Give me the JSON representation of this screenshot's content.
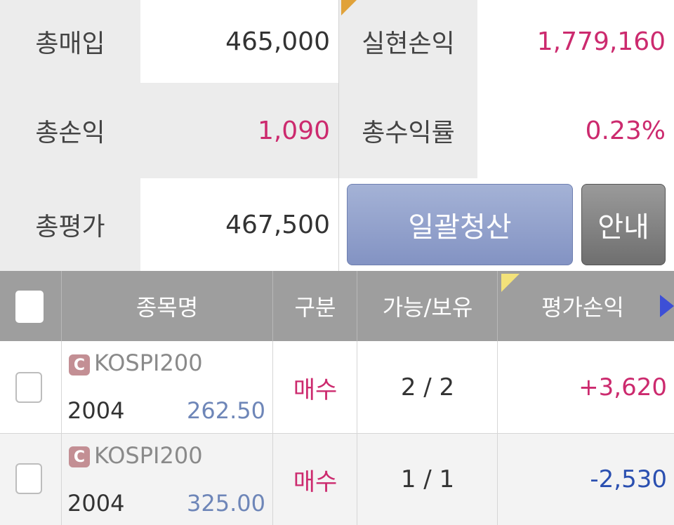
{
  "summary": {
    "row1": {
      "label_left": "총매입",
      "value_left": "465,000",
      "label_right": "실현손익",
      "value_right": "1,779,160"
    },
    "row2": {
      "label_left": "총손익",
      "value_left": "1,090",
      "label_right": "총수익률",
      "value_right": "0.23%"
    },
    "row3": {
      "label_left": "총평가",
      "value_left": "467,500"
    }
  },
  "buttons": {
    "liquidate_all": "일괄청산",
    "info": "안내"
  },
  "table": {
    "headers": {
      "name": "종목명",
      "type": "구분",
      "avail_hold": "가능/보유",
      "eval_pl": "평가손익"
    },
    "rows": [
      {
        "badge": "C",
        "symbol": "KOSPI200",
        "month": "2004",
        "strike": "262.50",
        "side": "매수",
        "qty": "2 / 2",
        "pl": "+3,620"
      },
      {
        "badge": "C",
        "symbol": "KOSPI200",
        "month": "2004",
        "strike": "325.00",
        "side": "매수",
        "qty": "1 / 1",
        "pl": "-2,530"
      }
    ]
  },
  "colors": {
    "positive": "#cc2a6e",
    "negative": "#2a4fb0",
    "button_main": "#8a9ac8",
    "header_bg": "#9e9e9e"
  },
  "icons": {
    "corner_mark": "yellow-corner-triangle",
    "next_arrow": "blue-right-triangle-icon"
  }
}
